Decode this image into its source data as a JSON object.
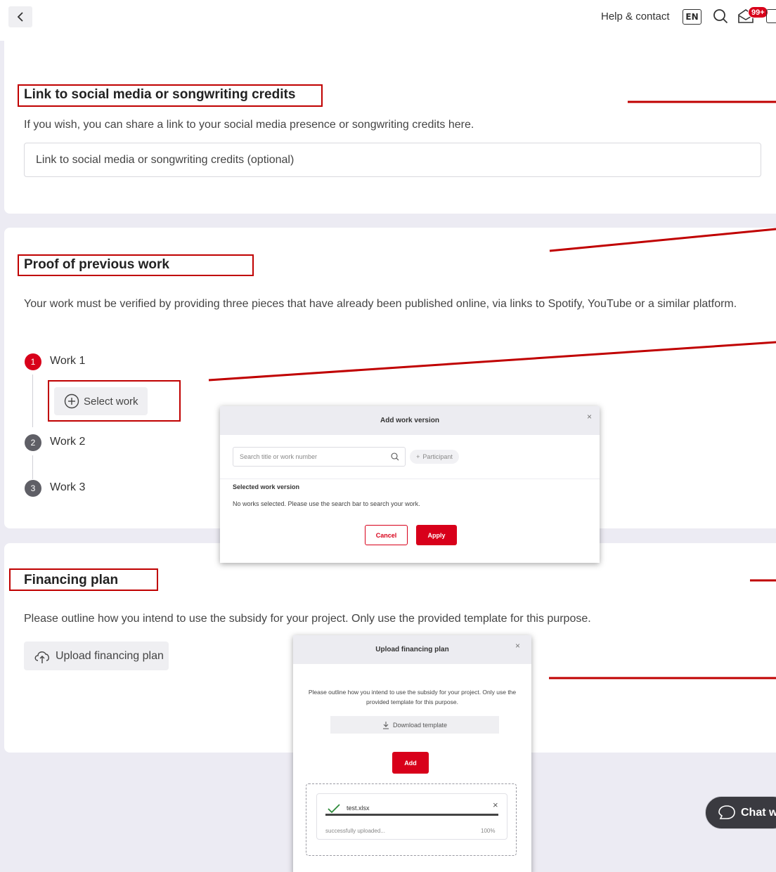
{
  "header": {
    "help_label": "Help & contact",
    "language": "EN",
    "inbox_badge": "99+"
  },
  "section_link": {
    "title": "Link to social media or songwriting credits",
    "description": "If you wish, you can share a link to your social media presence or songwriting credits here.",
    "input_placeholder": "Link to social media or songwriting credits (optional)"
  },
  "section_proof": {
    "title": "Proof of previous work",
    "description": "Your work must be verified by providing three pieces that have already been published online, via links to Spotify, YouTube or a similar platform.",
    "steps": [
      {
        "number": "1",
        "label": "Work 1"
      },
      {
        "number": "2",
        "label": "Work 2"
      },
      {
        "number": "3",
        "label": "Work 3"
      }
    ],
    "select_label": "Select work"
  },
  "dialog_work": {
    "title": "Add work version",
    "close": "×",
    "search_placeholder": "Search title or work number",
    "participant_label": "Participant",
    "selected_title": "Selected work version",
    "empty_text": "No works selected. Please use the search bar to search your work.",
    "cancel_label": "Cancel",
    "apply_label": "Apply"
  },
  "section_financing": {
    "title": "Financing plan",
    "description": "Please outline how you intend to use the subsidy for your project. Only use the provided template for this purpose.",
    "upload_label": "Upload financing plan"
  },
  "dialog_upload": {
    "title": "Upload financing plan",
    "close": "×",
    "description": "Please outline how you intend to use the subsidy for your project. Only use the provided template for this purpose.",
    "download_label": "Download template",
    "add_label": "Add",
    "file_name": "test.xlsx",
    "file_status": "successfully uploaded...",
    "file_progress": "100%",
    "file_close": "×",
    "progress_fraction": 1.0
  },
  "chat": {
    "label": "Chat w"
  },
  "colors": {
    "accent": "#d8001a",
    "annotation": "#c00000"
  }
}
